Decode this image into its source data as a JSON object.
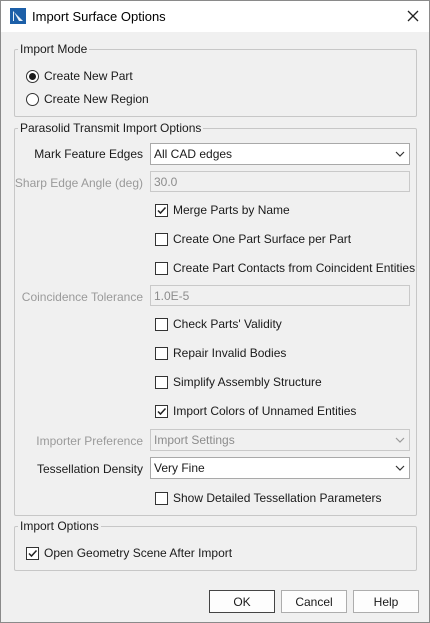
{
  "window": {
    "title": "Import Surface Options"
  },
  "import_mode": {
    "legend": "Import Mode",
    "options": [
      {
        "label": "Create New Part",
        "selected": true
      },
      {
        "label": "Create New Region",
        "selected": false
      }
    ]
  },
  "parasolid": {
    "legend": "Parasolid Transmit Import Options",
    "mark_feature_edges": {
      "label": "Mark Feature Edges",
      "value": "All CAD edges"
    },
    "sharp_edge_angle": {
      "label": "Sharp Edge Angle (deg)",
      "value": "30.0"
    },
    "merge_parts": {
      "label": "Merge Parts by Name",
      "checked": true
    },
    "one_part_surface": {
      "label": "Create One Part Surface per Part",
      "checked": false
    },
    "part_contacts": {
      "label": "Create Part Contacts from Coincident Entities",
      "checked": false
    },
    "coincidence_tolerance": {
      "label": "Coincidence Tolerance",
      "value": "1.0E-5"
    },
    "check_validity": {
      "label": "Check Parts' Validity",
      "checked": false
    },
    "repair_bodies": {
      "label": "Repair Invalid Bodies",
      "checked": false
    },
    "simplify_assembly": {
      "label": "Simplify Assembly Structure",
      "checked": false
    },
    "import_colors": {
      "label": "Import Colors of Unnamed Entities",
      "checked": true
    },
    "importer_preference": {
      "label": "Importer Preference",
      "value": "Import Settings"
    },
    "tessellation_density": {
      "label": "Tessellation Density",
      "value": "Very Fine"
    },
    "show_tessellation": {
      "label": "Show Detailed Tessellation Parameters",
      "checked": false
    }
  },
  "import_options": {
    "legend": "Import Options",
    "open_scene": {
      "label": "Open Geometry Scene After Import",
      "checked": true
    }
  },
  "buttons": {
    "ok": "OK",
    "cancel": "Cancel",
    "help": "Help"
  },
  "colors": {
    "accent": "#1c5fa8",
    "window_bg": "#f0f0f0",
    "border": "#c7c7c7"
  }
}
